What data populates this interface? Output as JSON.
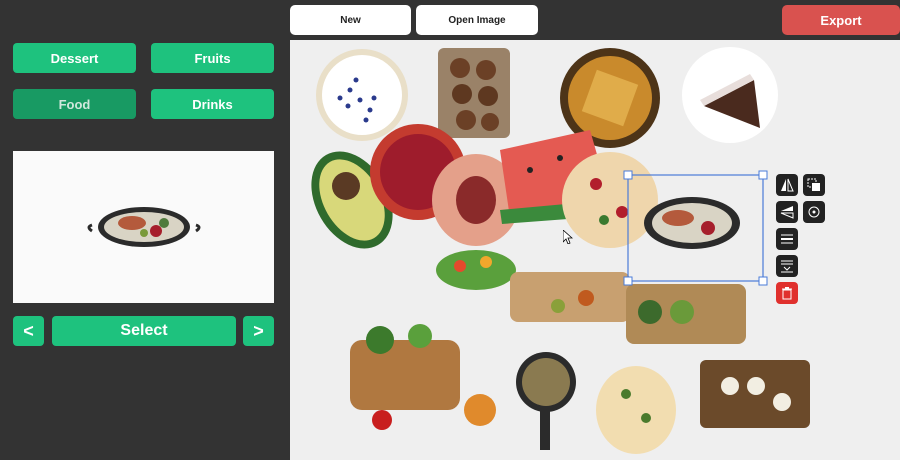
{
  "categories": [
    {
      "label": "Dessert",
      "active": false
    },
    {
      "label": "Fruits",
      "active": false
    },
    {
      "label": "Food",
      "active": true
    },
    {
      "label": "Drinks",
      "active": false
    }
  ],
  "nav": {
    "prev": "<",
    "select": "Select",
    "next": ">"
  },
  "toolbar": {
    "new": "New",
    "open_image": "Open Image",
    "export": "Export"
  },
  "colors": {
    "accent": "#1ec27e",
    "accent_active": "#189a63",
    "export": "#d9524f",
    "selection": "#4a7bd8",
    "delete": "#e0302d"
  },
  "tools": [
    "flip-horizontal-icon",
    "bring-front-icon",
    "flip-vertical-icon",
    "rotate-icon",
    "align-center-icon",
    "send-back-icon",
    "delete-icon"
  ]
}
